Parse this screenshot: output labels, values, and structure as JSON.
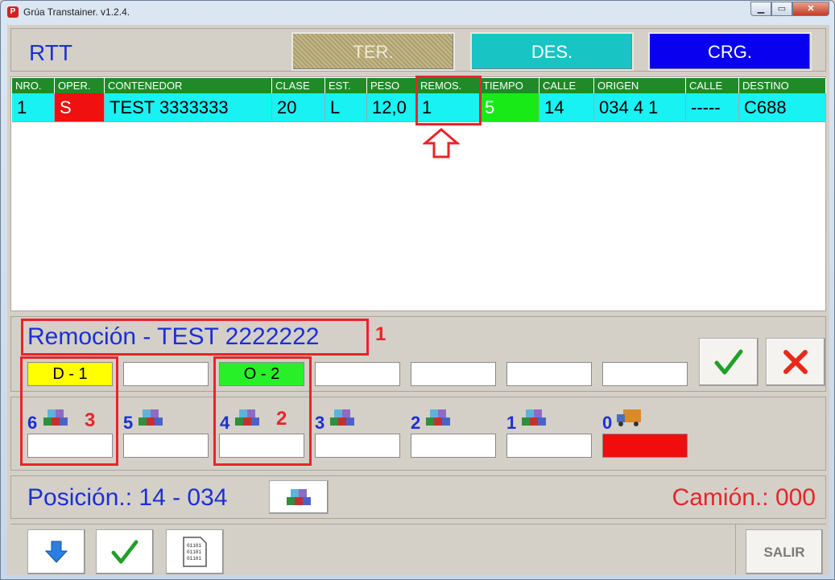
{
  "window": {
    "title": "Grúa Transtainer. v1.2.4.",
    "minimize_glyph": "▁",
    "maximize_glyph": "▭",
    "close_glyph": "✕",
    "app_icon_glyph": "P"
  },
  "header": {
    "brand": "RTT",
    "modes": [
      {
        "label": "TER.",
        "color": "#b6aa7c"
      },
      {
        "label": "DES.",
        "color": "#18c4c4"
      },
      {
        "label": "CRG.",
        "color": "#0a00f0"
      }
    ]
  },
  "table": {
    "columns": [
      "NRO.",
      "OPER.",
      "CONTENEDOR",
      "CLASE",
      "EST.",
      "PESO",
      "REMOS.",
      "TIEMPO",
      "CALLE",
      "ORIGEN",
      "CALLE",
      "DESTINO"
    ],
    "rows": [
      [
        "1",
        "S",
        "TEST 3333333",
        "20",
        "L",
        "12,0",
        "1",
        "5",
        "14",
        "034 4 1",
        "-----",
        "C688"
      ]
    ]
  },
  "removal": {
    "title": "Remoción - TEST 2222222",
    "slots": [
      "D - 1",
      "",
      "O - 2",
      "",
      "",
      "",
      ""
    ],
    "annotations": [
      "1",
      "2",
      "3"
    ]
  },
  "tiers": {
    "labels": [
      "6",
      "5",
      "4",
      "3",
      "2",
      "1",
      "0"
    ],
    "icons": [
      "container-stack-icon",
      "container-stack-icon",
      "container-stack-icon",
      "container-stack-icon",
      "container-stack-icon",
      "container-stack-icon",
      "truck-icon"
    ]
  },
  "position": {
    "label": "Posición.: 14 - 034",
    "camion": "Camión.: 000"
  },
  "toolbar": {
    "exit_label": "SALIR",
    "document_icon_text": "01101"
  },
  "colors": {
    "accent_blue": "#1c2fd6",
    "alert_red": "#e8242a",
    "grid_header": "#1f8a27",
    "grid_row": "#18f2f2"
  }
}
